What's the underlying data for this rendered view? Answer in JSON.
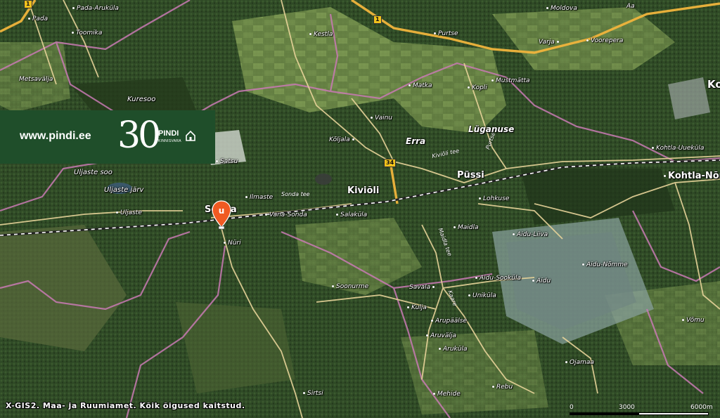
{
  "banner": {
    "url": "www.pindi.ee",
    "number": "30",
    "brand": "PINDI",
    "sub": "KINNISVARA"
  },
  "marker": {
    "letter": "u"
  },
  "attribution": "X-GIS2. Maa- ja Ruumiamet. Kõik õigused kaitstud.",
  "scale": {
    "labels": [
      "0",
      "3000",
      "6000m"
    ]
  },
  "road_shields": [
    "1",
    "1",
    "34"
  ],
  "road_labels": [
    "Sonda tee",
    "Kiviõli tee",
    "Purtse",
    "Maidla tee",
    "Kaare"
  ],
  "places": {
    "pada": "Pada",
    "pada_arukula": "Pada-Aruküla",
    "toomika": "Toomika",
    "kestla": "Kestla",
    "purtse": "Purtse",
    "moldova": "Moldova",
    "varja": "Varja",
    "voorepera": "Voorepera",
    "metsavalja": "Metsavälja",
    "kuresoo": "Kuresoo",
    "matka": "Matka",
    "kopli": "Kopli",
    "mustmatta": "Mustmätta",
    "vainu": "Vainu",
    "erra": "Erra",
    "luganuse": "Lüganuse",
    "koljala": "Kõljala",
    "satsu": "Satsu",
    "uljaste_soo": "Uljaste soo",
    "uljaste_jarv": "Uljaste järv",
    "uljaste": "Uljaste",
    "ilmaste": "Ilmaste",
    "sonda": "Sonda",
    "kivioli": "Kiviõli",
    "pussi": "Püssi",
    "vana_sonda": "Vana-Sonda",
    "salakula": "Salaküla",
    "lohkuse": "Lohkuse",
    "maidla": "Maidla",
    "aidu_liiva": "Aidu-Liiva",
    "nuri": "Nüri",
    "aidu_nomme": "Aidu-Nõmme",
    "aidu_sookula": "Aidu-Sooküla",
    "aidu": "Aidu",
    "soonurme": "Soonurme",
    "savala": "Savala",
    "unikula": "Uniküla",
    "kulja": "Kulja",
    "arupaalse": "Arupäälse",
    "aruvalja": "Aruvälja",
    "arukula": "Aruküla",
    "ojamaa": "Ojamaa",
    "sirtsi": "Sirtsi",
    "rebu": "Rebu",
    "mehide": "Mehide",
    "kohtla_uuekula": "Kohtla-Uueküla",
    "kohtla_nomme": "Kohtla-Nõm",
    "vomu": "Võmu",
    "ko": "Ko",
    "aa": "Aa"
  },
  "colors": {
    "banner_bg": "#1f4e2a",
    "road_major": "#f0b43c",
    "road_minor": "#e8d49a",
    "border": "#c97ab4",
    "marker": "#f05a22",
    "railway": "#ffffff"
  }
}
